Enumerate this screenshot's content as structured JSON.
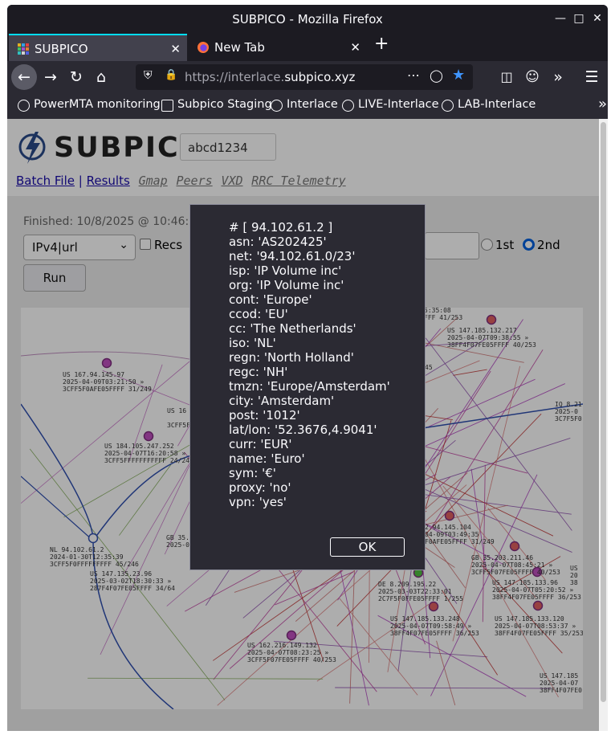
{
  "window": {
    "title": "SUBPICO - Mozilla Firefox"
  },
  "tabs": [
    {
      "label": "SUBPICO"
    },
    {
      "label": "New Tab"
    }
  ],
  "url": {
    "prefix": "https://interlace.",
    "domain": "subpico.xyz"
  },
  "bookmarks": [
    {
      "label": "PowerMTA monitoring"
    },
    {
      "label": "Subpico Staging"
    },
    {
      "label": "Interlace"
    },
    {
      "label": "LIVE-Interlace"
    },
    {
      "label": "LAB-Interlace"
    }
  ],
  "page": {
    "logo_text": "SUBPICO",
    "id_value": "abcd1234",
    "links": {
      "batch": "Batch File",
      "sep": "|",
      "results": "Results"
    },
    "tool_links": [
      "Gmap",
      "Peers",
      "VXD",
      "RRC Telemetry"
    ],
    "finished": "Finished: 10/8/2025 @ 10:46:5",
    "select_value": "IPv4|url",
    "recs_label": "Recs",
    "radio_1st": "1st",
    "radio_2nd": "2nd",
    "radio_selected": "2nd",
    "run_label": "Run"
  },
  "map_labels": [
    {
      "l1": "US 167.94.145.97",
      "l2": "2025-04-09T03:21:50 »",
      "l3": "3CFF5F0AFE05FFFF 31/249"
    },
    {
      "l1": "US 16",
      "l2": "",
      "l3": "3CFF5F"
    },
    {
      "l1": "US 184.105.247.252",
      "l2": "2025-04-07T16:20:58 »",
      "l3": "3CFF5FFFFFFFFFFF 24/24"
    },
    {
      "l1": "NL 94.102.61.2",
      "l2": "2024-01-30T12:35:39",
      "l3": "3CFF5F0FFFFFFFFF 45/246"
    },
    {
      "l1": "GB 35.",
      "l2": "2025-0",
      "l3": ""
    },
    {
      "l1": "US 147.135.23.96",
      "l2": "2025-03-02T18:30:33 »",
      "l3": "287F4F07FE05FFFF 34/64"
    },
    {
      "l1": "US 162.216.149.132",
      "l2": "2025-04-07T08:23:25 »",
      "l3": "3CFF5F07FE05FFFF 40/253"
    },
    {
      "l1": "US 147.185.132.217",
      "l2": "2025-04-07T09:38:55 »",
      "l3": "38FF4F07FE05FFFF 40/253"
    },
    {
      "l1": "5:35:08",
      "l2": "FFF 41/253",
      "l3": ""
    },
    {
      "l1": "45",
      "l2": "",
      "l3": ""
    },
    {
      "l1": "IQ 8.21",
      "l2": "2025-0",
      "l3": "3C7F5F0"
    },
    {
      "l1": "2.94.145.104",
      "l2": "04-09T03:49:35",
      "l3": "F0AFE05FFFF 31/249"
    },
    {
      "l1": "GB 35.203.211.46",
      "l2": "2025-04-07T08:45:21 »",
      "l3": "3CFF5F07FE05FFFF 40/253"
    },
    {
      "l1": "US 147.185.133.96",
      "l2": "2025-04-07T05:20:52 »",
      "l3": "38FF4F07FE05FFFF 36/253"
    },
    {
      "l1": "DE 8.209.195.22",
      "l2": "2025-03-03T22:33:01",
      "l3": "2C7F5F0FFE05FFFF 1/255"
    },
    {
      "l1": "US 147.185.133.248",
      "l2": "2025-04-07T09:58:49 »",
      "l3": "38FF4F07FE05FFFF 36/253"
    },
    {
      "l1": "US 147.185.133.120",
      "l2": "2025-04-07T08:53:37 »",
      "l3": "38FF4F07FE05FFFF 35/253"
    },
    {
      "l1": "US 147.185",
      "l2": "2025-04-07",
      "l3": "38FF4F07FE0"
    },
    {
      "l1": "US",
      "l2": "20",
      "l3": "38"
    }
  ],
  "dialog": {
    "lines": [
      "# [ 94.102.61.2 ]",
      "asn: 'AS202425'",
      "net: '94.102.61.0/23'",
      "isp: 'IP Volume inc'",
      "org: 'IP Volume inc'",
      "cont: 'Europe'",
      "ccod: 'EU'",
      "cc: 'The Netherlands'",
      "iso: 'NL'",
      "regn: 'North Holland'",
      "regc: 'NH'",
      "tmzn: 'Europe/Amsterdam'",
      "city: 'Amsterdam'",
      "post: '1012'",
      "lat/lon: '52.3676,4.9041'",
      "curr: 'EUR'",
      "name: 'Euro'",
      "sym: '€'",
      "proxy: 'no'",
      "vpn: 'yes'"
    ],
    "ok_label": "OK"
  },
  "colors": {
    "accent": "#0060df",
    "dialog_bg": "#2b2a33",
    "chrome_bg": "#1c1b22"
  }
}
